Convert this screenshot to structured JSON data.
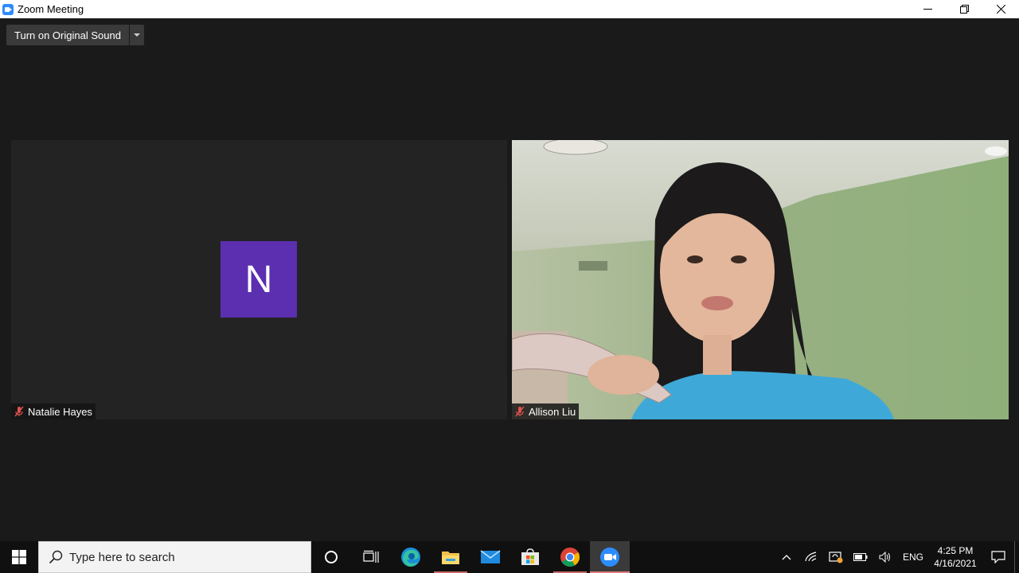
{
  "window": {
    "title": "Zoom Meeting"
  },
  "toolbar": {
    "original_sound_label": "Turn on Original Sound"
  },
  "participants": [
    {
      "name": "Natalie Hayes",
      "avatar_letter": "N",
      "avatar_color": "#5b2fb0",
      "muted": true,
      "video": false
    },
    {
      "name": "Allison Liu",
      "muted": true,
      "video": true
    }
  ],
  "taskbar": {
    "search_placeholder": "Type here to search",
    "pinned": [
      "cortana-icon",
      "task-view-icon",
      "edge-icon",
      "file-explorer-icon",
      "mail-icon",
      "store-icon",
      "chrome-icon",
      "zoom-icon"
    ],
    "active_app": "zoom-icon",
    "tray": {
      "language": "ENG",
      "time": "4:25 PM",
      "date": "4/16/2021"
    }
  },
  "colors": {
    "accent": "#2d8cff",
    "muted_mic": "#e0524d"
  }
}
